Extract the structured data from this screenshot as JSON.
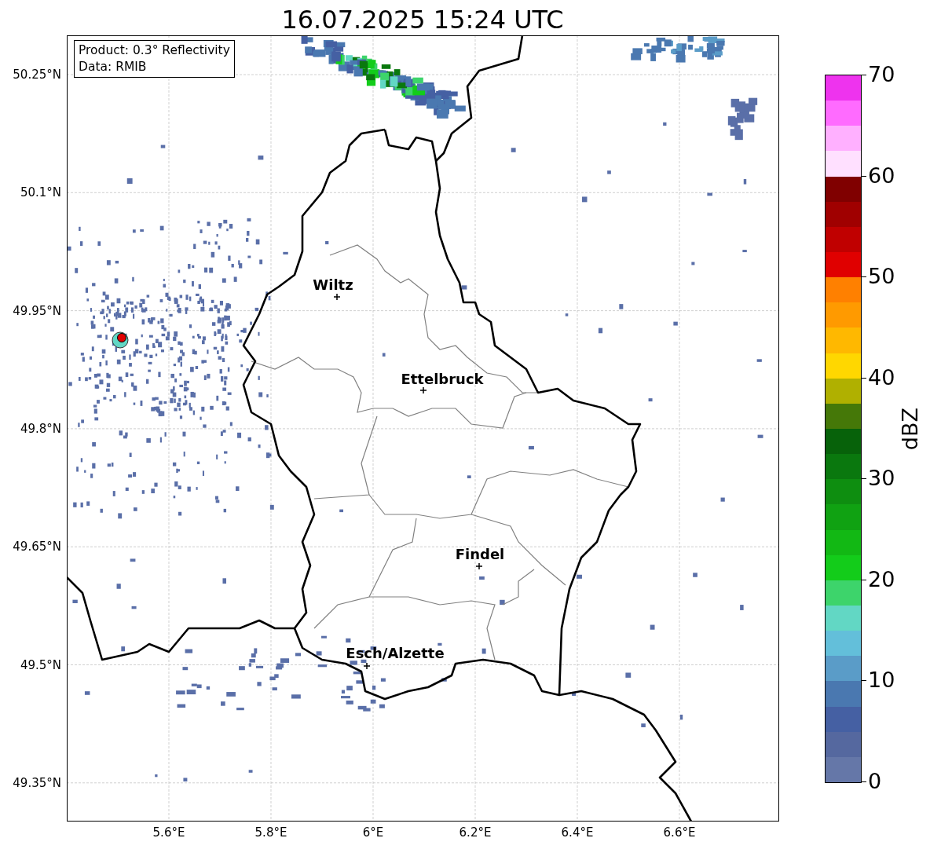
{
  "title": "16.07.2025 15:24 UTC",
  "info_box": [
    "Product: 0.3° Reflectivity",
    "Data: RMIB"
  ],
  "map": {
    "lat_ticks": [
      "50.25°N",
      "50.1°N",
      "49.95°N",
      "49.8°N",
      "49.65°N",
      "49.5°N",
      "49.35°N"
    ],
    "lon_ticks": [
      "5.6°E",
      "5.8°E",
      "6°E",
      "6.2°E",
      "6.4°E",
      "6.6°E"
    ],
    "cities": [
      {
        "name": "Wiltz"
      },
      {
        "name": "Ettelbruck"
      },
      {
        "name": "Findel"
      },
      {
        "name": "Esch/Alzette"
      }
    ]
  },
  "colorbar": {
    "label": "dBZ",
    "ticks": [
      "70",
      "60",
      "50",
      "40",
      "30",
      "20",
      "10",
      "0"
    ],
    "bands": [
      {
        "color": "#ee33ee"
      },
      {
        "color": "#ff6bff"
      },
      {
        "color": "#ffb0ff"
      },
      {
        "color": "#ffe0ff"
      },
      {
        "color": "#800000"
      },
      {
        "color": "#a00000"
      },
      {
        "color": "#c00000"
      },
      {
        "color": "#e00000"
      },
      {
        "color": "#ff8000"
      },
      {
        "color": "#ff9a00"
      },
      {
        "color": "#ffb800"
      },
      {
        "color": "#ffd700"
      },
      {
        "color": "#b0b000"
      },
      {
        "color": "#457808"
      },
      {
        "color": "#07620a"
      },
      {
        "color": "#0a780e"
      },
      {
        "color": "#0e8e10"
      },
      {
        "color": "#10a212"
      },
      {
        "color": "#12b814"
      },
      {
        "color": "#13cc1a"
      },
      {
        "color": "#3dd46b"
      },
      {
        "color": "#62d7c4"
      },
      {
        "color": "#63bfda"
      },
      {
        "color": "#5a9cc8"
      },
      {
        "color": "#4a78b0"
      },
      {
        "color": "#4560a3"
      },
      {
        "color": "#55689f"
      },
      {
        "color": "#6577a8"
      }
    ]
  }
}
